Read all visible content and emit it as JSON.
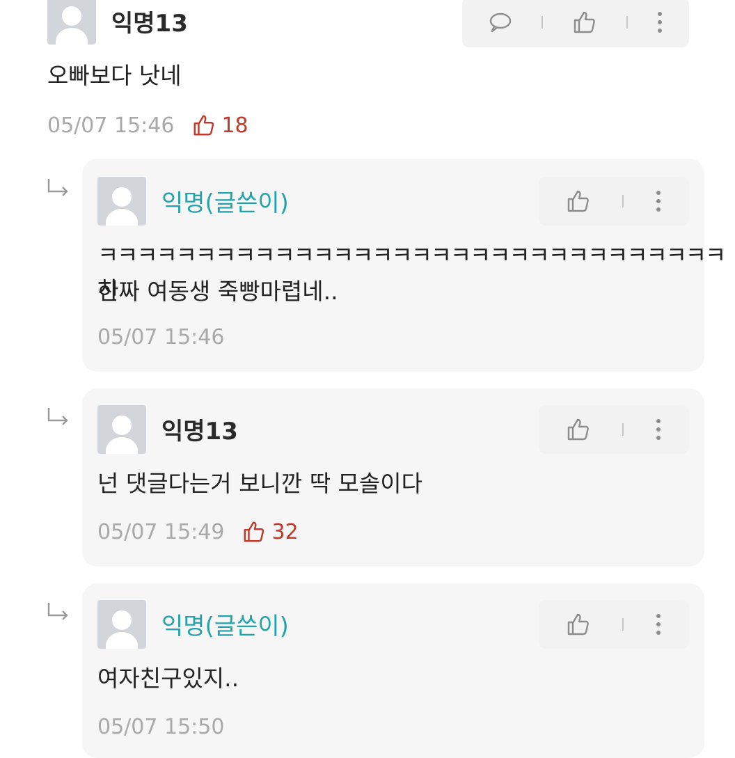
{
  "comments": [
    {
      "author": "익명13",
      "text": "오빠보다 낫네",
      "time": "05/07 15:46",
      "likes": "18",
      "actions": [
        "comment-icon",
        "thumbs-up-icon",
        "more-icon"
      ]
    }
  ],
  "replies": [
    {
      "author": "익명(글쓴이)",
      "is_op": true,
      "text_lines": [
        "ㅋㅋㅋㅋㅋㅋㅋㅋㅋㅋㅋㅋㅋㅋㅋㅋㅋㅋㅋㅋㅋㅋㅋㅋㅋㅋㅋㅋㅋㅋㅋㅋ하",
        "진짜 여동생 죽빵마렵네.."
      ],
      "time": "05/07 15:46",
      "likes": ""
    },
    {
      "author": "익명13",
      "is_op": false,
      "text_lines": [
        "넌 댓글다는거 보니깐 딱 모솔이다"
      ],
      "time": "05/07 15:49",
      "likes": "32"
    },
    {
      "author": "익명(글쓴이)",
      "is_op": true,
      "text_lines": [
        "여자친구있지.."
      ],
      "time": "05/07 15:50",
      "likes": ""
    }
  ],
  "colors": {
    "op_name": "#22a3a9",
    "like_red": "#c0392b",
    "meta_gray": "#a9a9a9",
    "reply_bg": "#f6f6f6"
  }
}
